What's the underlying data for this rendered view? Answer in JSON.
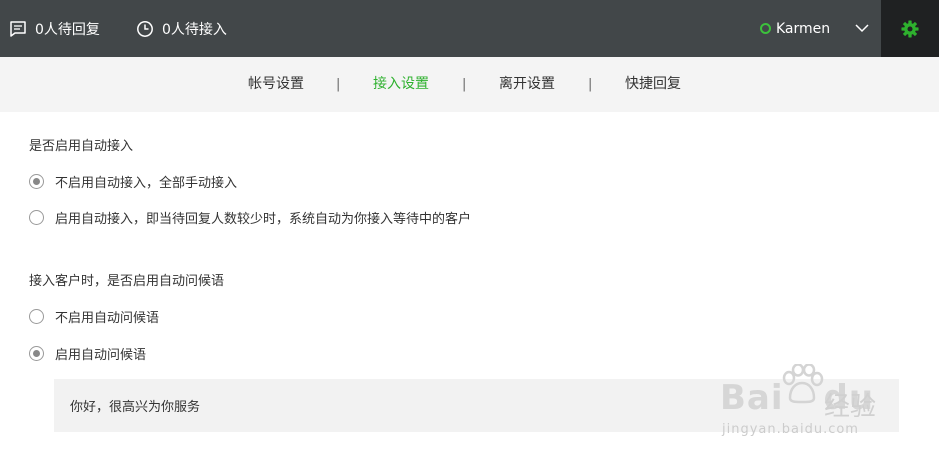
{
  "header": {
    "pending_reply": "0人待回复",
    "pending_accept": "0人待接入",
    "user_name": "Karmen",
    "icons": {
      "reply": "chat-bubble-icon",
      "wait": "clock-icon",
      "dropdown": "chevron-down-icon",
      "settings": "gear-icon"
    },
    "colors": {
      "bar": "#424749",
      "online": "#3cc13c",
      "settings_bg": "#1f2122"
    }
  },
  "tabs": [
    {
      "label": "帐号设置",
      "active": false
    },
    {
      "label": "接入设置",
      "active": true
    },
    {
      "label": "离开设置",
      "active": false
    },
    {
      "label": "快捷回复",
      "active": false
    }
  ],
  "tab_separator": "|",
  "sections": [
    {
      "title": "是否启用自动接入",
      "options": [
        {
          "label": "不启用自动接入，全部手动接入",
          "checked": true
        },
        {
          "label": "启用自动接入，即当待回复人数较少时，系统自动为你接入等待中的客户",
          "checked": false
        }
      ]
    },
    {
      "title": "接入客户时，是否启用自动问候语",
      "options": [
        {
          "label": "不启用自动问候语",
          "checked": false
        },
        {
          "label": "启用自动问候语",
          "checked": true
        }
      ]
    }
  ],
  "greeting_text": "你好，很高兴为你服务",
  "watermark": {
    "brand": "Bai",
    "brand_tail": "du",
    "cn": "经验",
    "url": "jingyan.baidu.com"
  },
  "accent_color": "#2eb12e"
}
